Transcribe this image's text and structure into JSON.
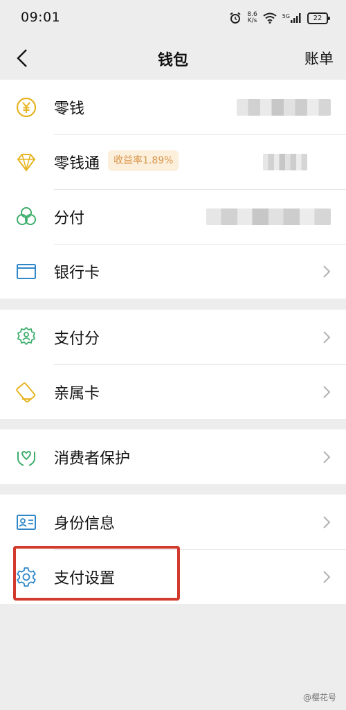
{
  "status_bar": {
    "time": "09:01",
    "net_speed_value": "8.6",
    "net_speed_unit": "K/s",
    "network": "5G",
    "battery": "22"
  },
  "nav": {
    "title": "钱包",
    "right_action": "账单"
  },
  "groups": [
    {
      "items": [
        {
          "label": "零钱",
          "icon": "yen-coin-icon",
          "masked_value": true
        },
        {
          "label": "零钱通",
          "icon": "diamond-icon",
          "badge": "收益率1.89%",
          "masked_value": true
        },
        {
          "label": "分付",
          "icon": "trefoil-icon",
          "masked_value": true
        },
        {
          "label": "银行卡",
          "icon": "bank-card-icon",
          "chevron": true
        }
      ]
    },
    {
      "items": [
        {
          "label": "支付分",
          "icon": "credit-score-icon",
          "chevron": true
        },
        {
          "label": "亲属卡",
          "icon": "family-card-icon",
          "chevron": true
        }
      ]
    },
    {
      "items": [
        {
          "label": "消费者保护",
          "icon": "protect-hands-icon",
          "chevron": true
        }
      ]
    },
    {
      "items": [
        {
          "label": "身份信息",
          "icon": "id-card-icon",
          "chevron": true
        },
        {
          "label": "支付设置",
          "icon": "gear-icon",
          "chevron": true,
          "highlighted": true
        }
      ]
    }
  ],
  "watermark": "@樱花号",
  "colors": {
    "background": "#ededed",
    "icon_green": "#3dae6b",
    "icon_yellow": "#e6b422",
    "badge_text": "#d9954a",
    "badge_bg": "#fcefdc",
    "highlight_red": "#d13a2c"
  }
}
